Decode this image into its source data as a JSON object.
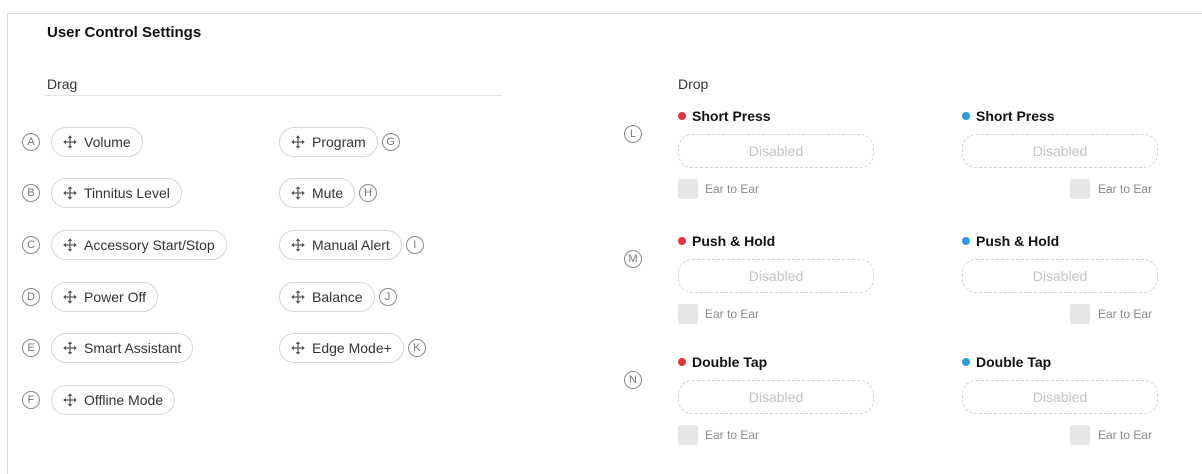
{
  "title": "User Control Settings",
  "drag": {
    "heading": "Drag",
    "left": [
      {
        "badge": "A",
        "label": "Volume"
      },
      {
        "badge": "B",
        "label": "Tinnitus Level"
      },
      {
        "badge": "C",
        "label": "Accessory Start/Stop"
      },
      {
        "badge": "D",
        "label": "Power Off"
      },
      {
        "badge": "E",
        "label": "Smart Assistant"
      },
      {
        "badge": "F",
        "label": "Offline Mode"
      }
    ],
    "right": [
      {
        "badge": "G",
        "label": "Program"
      },
      {
        "badge": "H",
        "label": "Mute"
      },
      {
        "badge": "I",
        "label": "Manual Alert"
      },
      {
        "badge": "J",
        "label": "Balance"
      },
      {
        "badge": "K",
        "label": "Edge Mode+"
      }
    ]
  },
  "drop": {
    "heading": "Drop",
    "colors": {
      "left": "#e5323b",
      "right": "#2b9be0"
    },
    "rows": [
      {
        "badge": "L",
        "left_title": "Short Press",
        "right_title": "Short Press",
        "left_slot": "Disabled",
        "right_slot": "Disabled",
        "left_ete": "Ear to Ear",
        "right_ete": "Ear to Ear"
      },
      {
        "badge": "M",
        "left_title": "Push & Hold",
        "right_title": "Push & Hold",
        "left_slot": "Disabled",
        "right_slot": "Disabled",
        "left_ete": "Ear to Ear",
        "right_ete": "Ear to Ear"
      },
      {
        "badge": "N",
        "left_title": "Double Tap",
        "right_title": "Double Tap",
        "left_slot": "Disabled",
        "right_slot": "Disabled",
        "left_ete": "Ear to Ear",
        "right_ete": "Ear to Ear"
      }
    ]
  }
}
